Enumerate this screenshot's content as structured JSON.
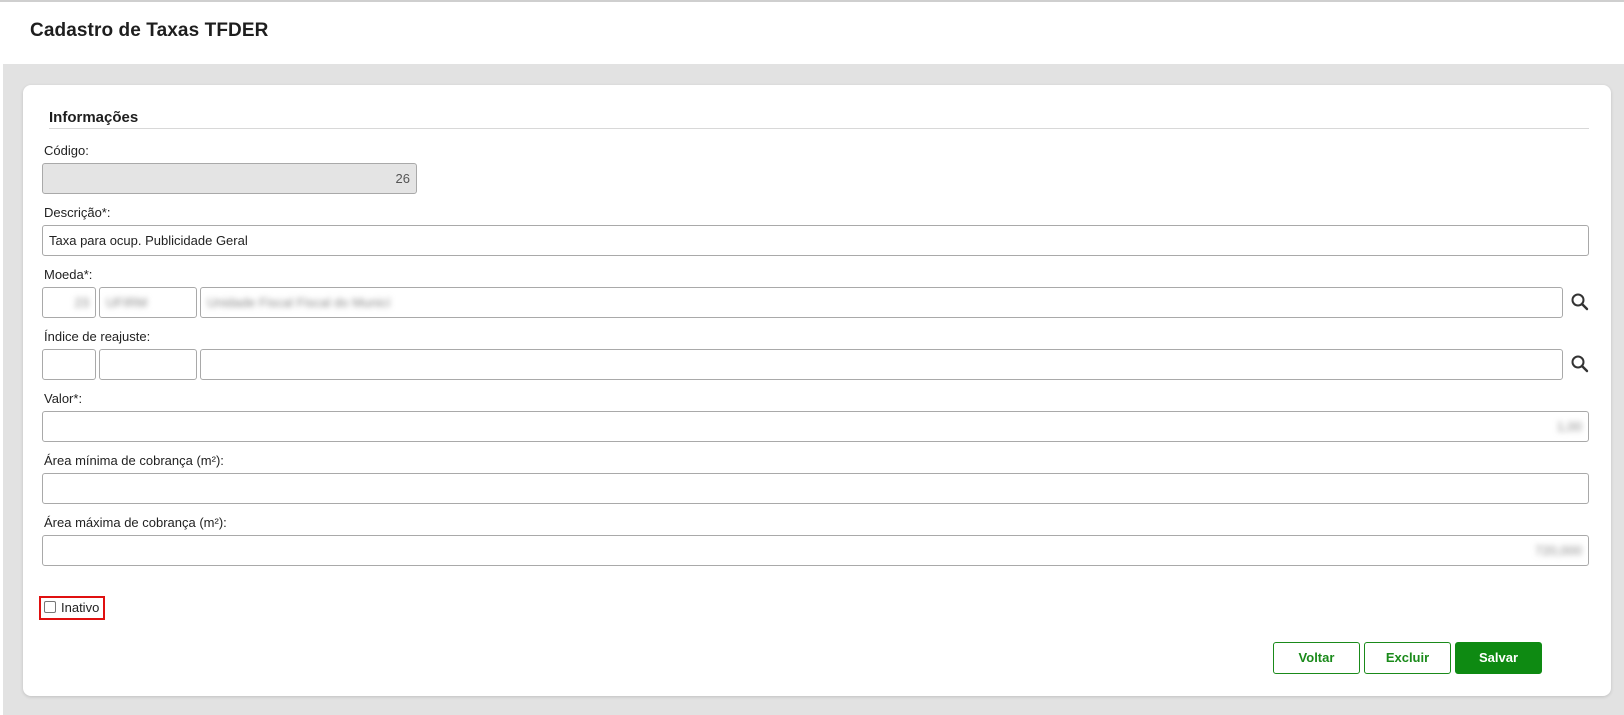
{
  "page": {
    "title": "Cadastro de Taxas TFDER"
  },
  "section": {
    "title": "Informações"
  },
  "fields": {
    "codigo": {
      "label": "Código:",
      "value": "26"
    },
    "descricao": {
      "label": "Descrição*:",
      "value": "Taxa para ocup. Publicidade Geral"
    },
    "moeda": {
      "label": "Moeda*:",
      "code": "23",
      "symbol": "UFIRM",
      "description": "Unidade Fiscal Fiscal do Municí"
    },
    "indice": {
      "label": "Índice de reajuste:",
      "code": "",
      "symbol": "",
      "description": ""
    },
    "valor": {
      "label": "Valor*:",
      "value": "1,00"
    },
    "area_minima": {
      "label": "Área mínima de cobrança (m²):",
      "value": ""
    },
    "area_maxima": {
      "label": "Área máxima de cobrança (m²):",
      "value": "720,000"
    }
  },
  "inativo": {
    "label": "Inativo",
    "checked": false
  },
  "actions": {
    "voltar": "Voltar",
    "excluir": "Excluir",
    "salvar": "Salvar"
  },
  "colors": {
    "accent": "#0e8a12",
    "highlight_border": "#e01010",
    "background": "#e2e2e2"
  },
  "icons": {
    "moeda_search": "search-icon",
    "indice_search": "search-icon"
  }
}
